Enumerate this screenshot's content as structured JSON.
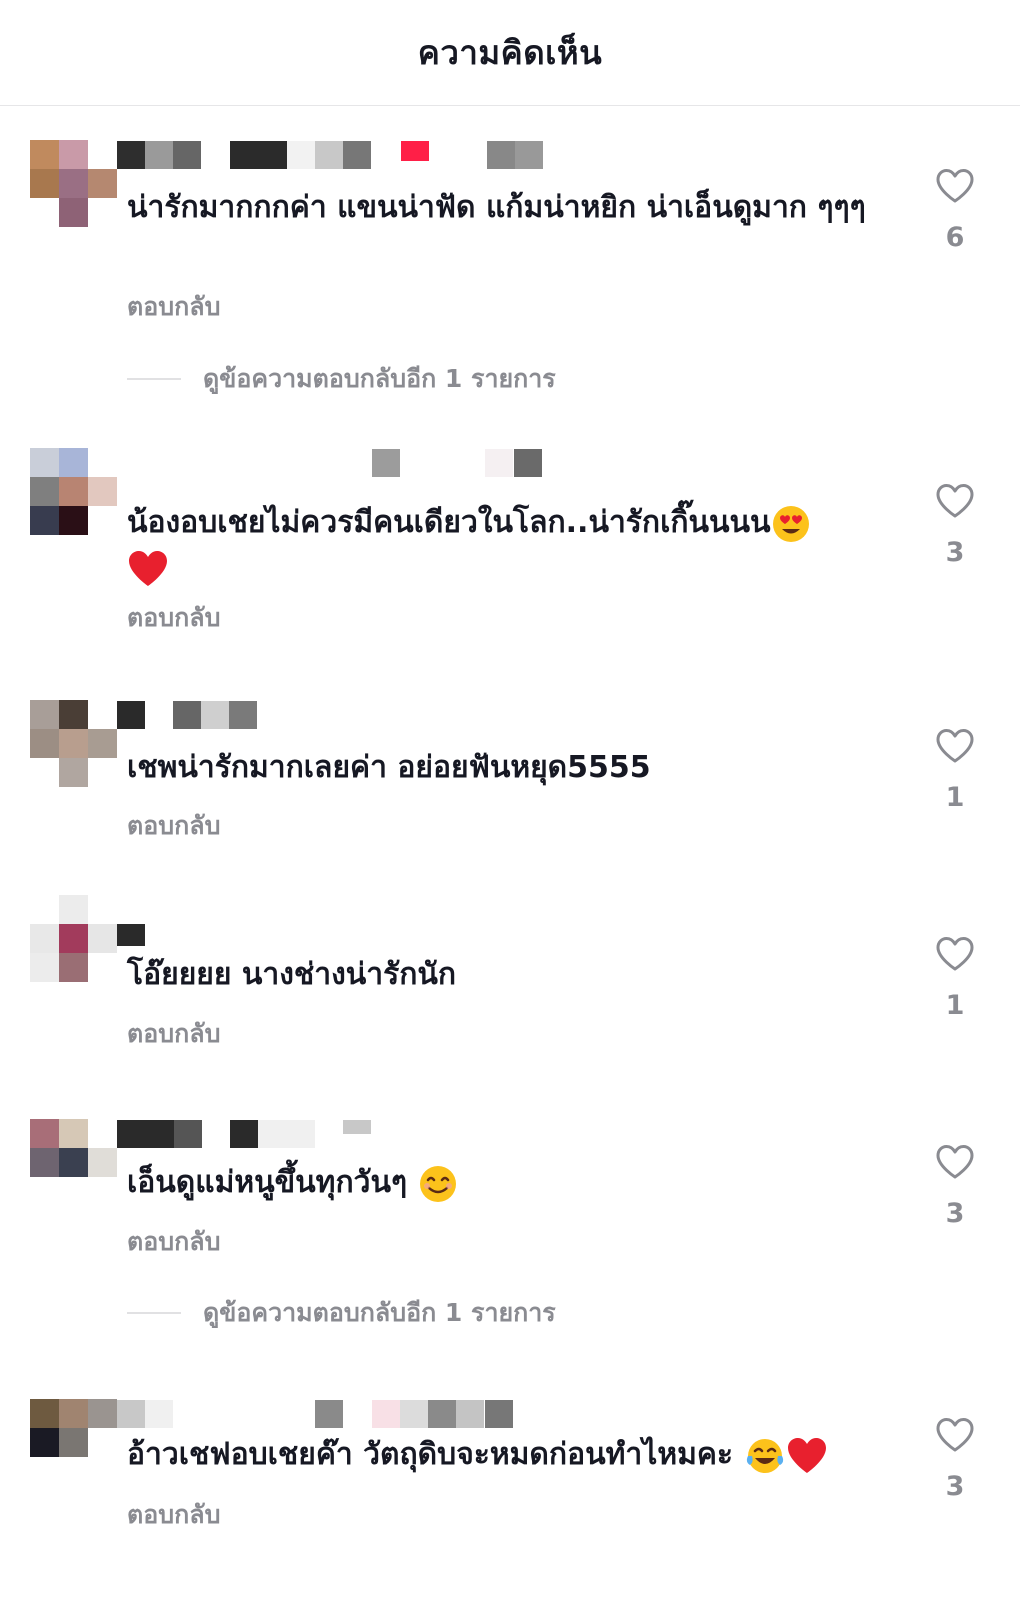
{
  "header": {
    "title": "ความคิดเห็น"
  },
  "comments": [
    {
      "text": "น่ารักมากกกค่า  แขนน่าฟัด แก้มน่าหยิก  น่าเอ็นดูมาก ๆๆๆ",
      "reply_label": "ตอบกลับ",
      "likes": "6",
      "more_replies": "ดูข้อความตอบกลับอีก 1 รายการ"
    },
    {
      "text": "น้องอบเชยไม่ควรมีคนเดียวในโลก..น่ารักเกิ๊นนนน",
      "reply_label": "ตอบกลับ",
      "likes": "3"
    },
    {
      "text": "เชพน่ารักมากเลยค่า อย่อยฟันหยุด5555",
      "reply_label": "ตอบกลับ",
      "likes": "1"
    },
    {
      "text": "โอ๊ยยยย นางช่างน่ารักนัก",
      "reply_label": "ตอบกลับ",
      "likes": "1"
    },
    {
      "text": "เอ็นดูแม่หนูขึ้นทุกวันๆ",
      "reply_label": "ตอบกลับ",
      "likes": "3",
      "more_replies": "ดูข้อความตอบกลับอีก 1 รายการ"
    },
    {
      "text": "อ้าวเชฟอบเชยค๊า วัตถุดิบจะหมดก่อนทำไหมคะ",
      "reply_label": "ตอบกลับ",
      "likes": "3"
    }
  ],
  "icons": {
    "like": "heart-outline-icon"
  },
  "colors": {
    "text": "#161823",
    "muted": "#8a8b91",
    "divider": "#e6e6e8",
    "heart_emoji": "#e8202e"
  }
}
